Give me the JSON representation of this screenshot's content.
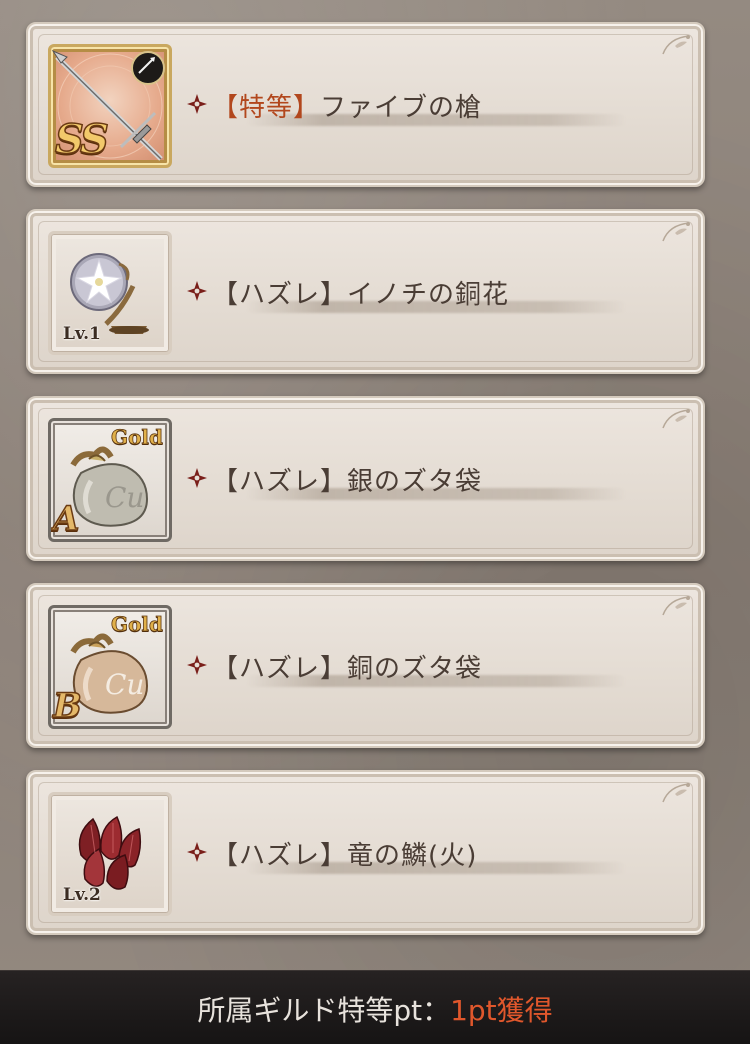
{
  "items": [
    {
      "tag_open": "【",
      "tag": "特等",
      "tag_close": "】",
      "name": "ファイブの槍",
      "special": true,
      "thumb_style": "ornate",
      "icon": "spear-weapon-icon",
      "badge": "SS",
      "element_icon": "spear-type-icon"
    },
    {
      "tag_open": "【",
      "tag": "ハズレ",
      "tag_close": "】",
      "name": "イノチの銅花",
      "special": false,
      "thumb_style": "plain",
      "icon": "silver-flower-item-icon",
      "level": "Lv.1"
    },
    {
      "tag_open": "【",
      "tag": "ハズレ",
      "tag_close": "】",
      "name": "銀のズタ袋",
      "special": false,
      "thumb_style": "gold",
      "icon": "silver-gold-bag-icon",
      "gold_label": "Gold",
      "grade": "A"
    },
    {
      "tag_open": "【",
      "tag": "ハズレ",
      "tag_close": "】",
      "name": "銅のズタ袋",
      "special": false,
      "thumb_style": "gold",
      "icon": "bronze-gold-bag-icon",
      "gold_label": "Gold",
      "grade": "B"
    },
    {
      "tag_open": "【",
      "tag": "ハズレ",
      "tag_close": "】",
      "name": "竜の鱗(火)",
      "special": false,
      "thumb_style": "plain",
      "icon": "fire-dragon-scale-icon",
      "level": "Lv.2"
    }
  ],
  "footer": {
    "label": "所属ギルド特等pt：",
    "value": "1pt獲得"
  },
  "colors": {
    "special_tag": "#b2471d",
    "text": "#4a3d35",
    "footer_value": "#e0572c",
    "bullet": "#7a1f1a"
  }
}
